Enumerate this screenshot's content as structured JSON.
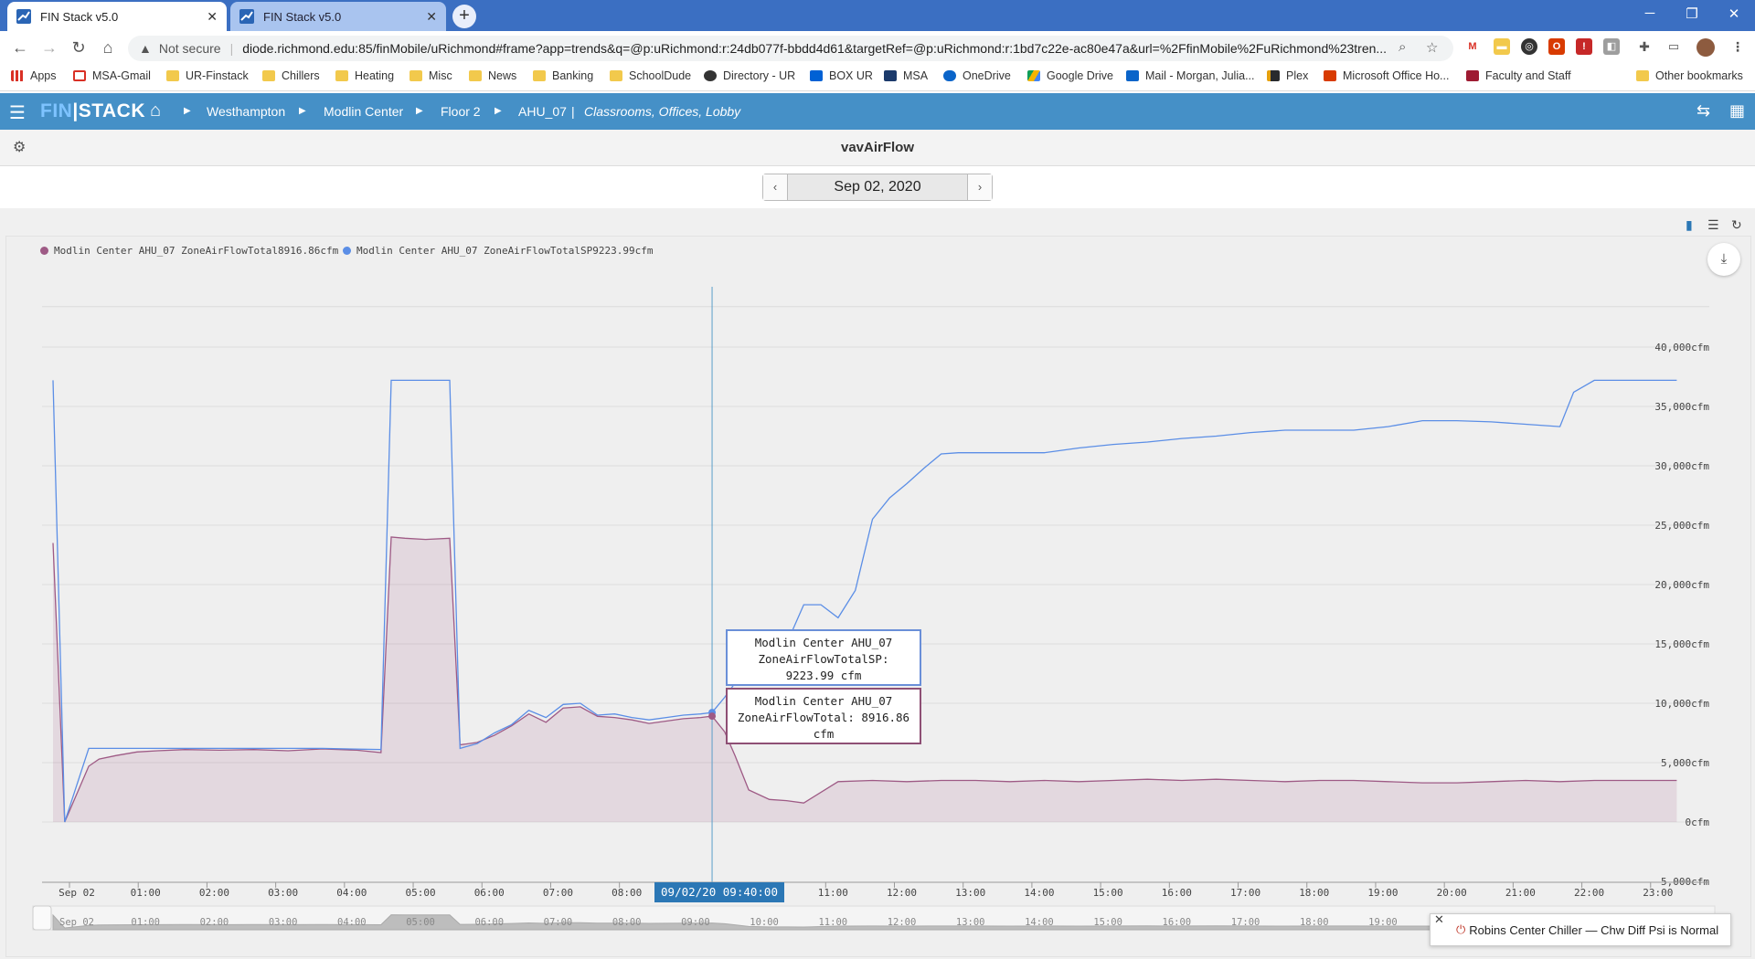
{
  "browser": {
    "tabs": [
      {
        "title": "FIN Stack v5.0",
        "active": true
      },
      {
        "title": "FIN Stack v5.0",
        "active": false
      }
    ],
    "new_tab": "+",
    "window_controls": [
      "─",
      "❐",
      "✕"
    ],
    "security_label": "Not secure",
    "url": "diode.richmond.edu:85/finMobile/uRichmond#frame?app=trends&q=@p:uRichmond:r:24db077f-bbdd4d61&targetRef=@p:uRichmond:r:1bd7c22e-ac80e47a&url=%2FfinMobile%2FuRichmond%23tren...",
    "bookmarks": [
      {
        "label": "Apps",
        "icon": "apps-grid-icon"
      },
      {
        "label": "MSA-Gmail",
        "icon": "gmail-icon"
      },
      {
        "label": "UR-Finstack",
        "icon": "folder-icon"
      },
      {
        "label": "Chillers",
        "icon": "folder-icon"
      },
      {
        "label": "Heating",
        "icon": "folder-icon"
      },
      {
        "label": "Misc",
        "icon": "folder-icon"
      },
      {
        "label": "News",
        "icon": "folder-icon"
      },
      {
        "label": "Banking",
        "icon": "folder-icon"
      },
      {
        "label": "SchoolDude",
        "icon": "folder-icon"
      },
      {
        "label": "Directory - UR",
        "icon": "directory-icon"
      },
      {
        "label": "BOX UR",
        "icon": "box-icon"
      },
      {
        "label": "MSA",
        "icon": "msa-icon"
      },
      {
        "label": "OneDrive",
        "icon": "onedrive-icon"
      },
      {
        "label": "Google Drive",
        "icon": "google-drive-icon"
      },
      {
        "label": "Mail - Morgan, Julia...",
        "icon": "outlook-icon"
      },
      {
        "label": "Plex",
        "icon": "plex-icon"
      },
      {
        "label": "Microsoft Office Ho...",
        "icon": "office-icon"
      },
      {
        "label": "Faculty and Staff",
        "icon": "faculty-icon"
      }
    ],
    "other_bookmarks": "Other bookmarks"
  },
  "app": {
    "logo_fin": "FIN",
    "logo_stack": "STACK",
    "breadcrumb": [
      "Westhampton",
      "Modlin Center",
      "Floor 2",
      "AHU_07"
    ],
    "breadcrumb_separator": "|",
    "breadcrumb_desc": "Classrooms, Offices, Lobby",
    "page_title": "vavAirFlow",
    "date": "Sep 02, 2020",
    "prev": "‹",
    "next": "›"
  },
  "colors": {
    "appbar": "#4590c7",
    "total_series": "#9e5a85",
    "sp_series": "#5b8ee6",
    "cursor": "#2b77b5"
  },
  "legend": [
    {
      "text": "Modlin Center AHU_07 ZoneAirFlowTotal8916.86cfm",
      "color": "#9e5a85"
    },
    {
      "text": "Modlin Center AHU_07 ZoneAirFlowTotalSP9223.99cfm",
      "color": "#5b8ee6"
    }
  ],
  "tooltips": {
    "sp": [
      "Modlin Center AHU_07",
      "ZoneAirFlowTotalSP:",
      "9223.99 cfm"
    ],
    "total": [
      "Modlin Center AHU_07",
      "ZoneAirFlowTotal: 8916.86",
      "cfm"
    ]
  },
  "x_hover_label": "09/02/20 09:40:00",
  "toast": "Robins Center Chiller — Chw Diff Psi is Normal",
  "chart_data": {
    "type": "area",
    "title": "vavAirFlow",
    "date": "Sep 02, 2020",
    "ylim": [
      -5000,
      40000
    ],
    "yticks": [
      -5000,
      0,
      5000,
      10000,
      15000,
      20000,
      25000,
      30000,
      35000,
      40000
    ],
    "ytick_labels": [
      "-5,000cfm",
      "0cfm",
      "5,000cfm",
      "10,000cfm",
      "15,000cfm",
      "20,000cfm",
      "25,000cfm",
      "30,000cfm",
      "35,000cfm",
      "40,000cfm"
    ],
    "xlim": [
      0,
      24
    ],
    "xticks": [
      0,
      1,
      2,
      3,
      4,
      5,
      6,
      7,
      8,
      9,
      10,
      11,
      12,
      13,
      14,
      15,
      16,
      17,
      18,
      19,
      20,
      21,
      22,
      23
    ],
    "xtick_labels": [
      "Sep 02",
      "01:00",
      "02:00",
      "03:00",
      "04:00",
      "05:00",
      "06:00",
      "07:00",
      "08:00",
      "09:00",
      "10:00",
      "11:00",
      "12:00",
      "13:00",
      "14:00",
      "15:00",
      "16:00",
      "17:00",
      "18:00",
      "19:00",
      "20:00",
      "21:00",
      "22:00",
      "23:00"
    ],
    "cursor_x": 9.667,
    "grid": true,
    "legend_position": "top-left",
    "series": [
      {
        "name": "Modlin Center AHU_07 ZoneAirFlowTotal",
        "style": "area",
        "x": [
          0.08,
          0.25,
          0.6,
          0.75,
          1.0,
          1.3,
          1.6,
          2.0,
          2.5,
          3.0,
          3.5,
          4.0,
          4.5,
          4.85,
          5.0,
          5.2,
          5.5,
          5.85,
          6.0,
          6.25,
          6.5,
          6.75,
          7.0,
          7.25,
          7.5,
          7.75,
          8.0,
          8.25,
          8.5,
          8.75,
          9.0,
          9.25,
          9.5,
          9.667,
          9.85,
          10.0,
          10.2,
          10.5,
          10.75,
          11.0,
          11.5,
          12.0,
          12.5,
          13.0,
          13.5,
          14.0,
          14.5,
          15.0,
          15.5,
          16.0,
          16.5,
          17.0,
          17.5,
          18.0,
          18.5,
          19.0,
          19.5,
          20.0,
          20.5,
          21.0,
          21.5,
          22.0,
          22.5,
          23.0,
          23.7
        ],
        "y": [
          23500,
          0,
          4700,
          5300,
          5600,
          5900,
          6000,
          6100,
          6050,
          6100,
          6000,
          6150,
          6050,
          5850,
          24000,
          23900,
          23800,
          23900,
          6500,
          6700,
          7300,
          8100,
          9100,
          8400,
          9600,
          9700,
          8900,
          8800,
          8600,
          8300,
          8500,
          8700,
          8800,
          8917,
          7600,
          5600,
          2700,
          1900,
          1800,
          1600,
          3400,
          3500,
          3400,
          3500,
          3500,
          3400,
          3500,
          3400,
          3500,
          3600,
          3500,
          3600,
          3500,
          3400,
          3500,
          3500,
          3400,
          3300,
          3300,
          3400,
          3500,
          3400,
          3500,
          3500,
          3500
        ]
      },
      {
        "name": "Modlin Center AHU_07 ZoneAirFlowTotalSP",
        "style": "line",
        "x": [
          0.08,
          0.25,
          0.6,
          1.0,
          2.0,
          3.0,
          4.0,
          4.85,
          5.0,
          5.85,
          6.0,
          6.25,
          6.5,
          6.75,
          7.0,
          7.25,
          7.5,
          7.75,
          8.0,
          8.25,
          8.5,
          8.75,
          9.0,
          9.25,
          9.5,
          9.667,
          9.85,
          10.0,
          10.25,
          10.5,
          10.75,
          11.0,
          11.25,
          11.5,
          11.75,
          12.0,
          12.25,
          12.5,
          12.75,
          13.0,
          13.25,
          13.5,
          14.0,
          14.5,
          15.0,
          15.5,
          16.0,
          16.5,
          17.0,
          17.5,
          18.0,
          18.5,
          19.0,
          19.5,
          20.0,
          20.5,
          21.0,
          21.5,
          22.0,
          22.2,
          22.5,
          23.0,
          23.7
        ],
        "y": [
          37200,
          0,
          6200,
          6200,
          6200,
          6200,
          6200,
          6100,
          37200,
          37200,
          6200,
          6600,
          7500,
          8200,
          9400,
          8800,
          9900,
          10000,
          9000,
          9100,
          8800,
          8600,
          8800,
          9000,
          9100,
          9224,
          10500,
          11700,
          12000,
          13500,
          15000,
          18300,
          18300,
          17200,
          19500,
          25500,
          27300,
          28500,
          29800,
          31000,
          31100,
          31100,
          31100,
          31100,
          31500,
          31800,
          32000,
          32300,
          32500,
          32800,
          33000,
          33000,
          33000,
          33300,
          33800,
          33800,
          33700,
          33500,
          33300,
          36200,
          37200,
          37200,
          37200
        ]
      }
    ]
  }
}
